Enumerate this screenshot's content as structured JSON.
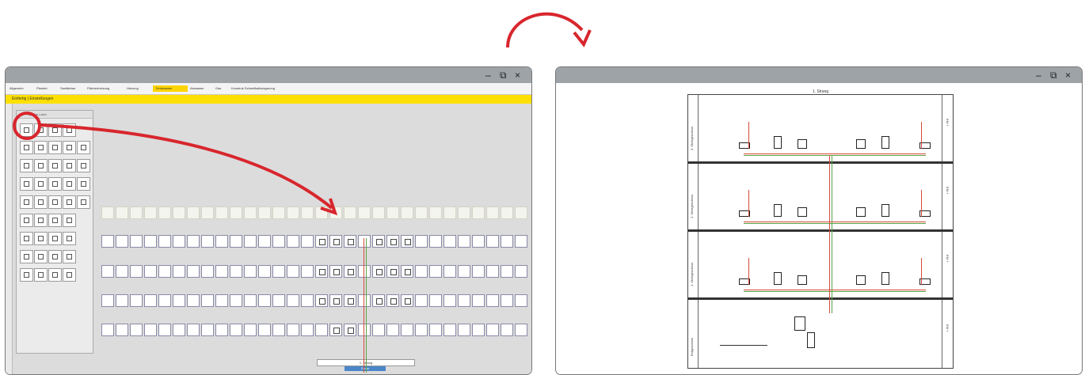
{
  "window_controls": {
    "minimize": "–",
    "maximize": "⧉",
    "close": "×"
  },
  "left_window": {
    "tabs": [
      "Allgemein",
      "Planbet",
      "Sanitärbau",
      "Flächenheizung",
      "Heizung",
      "Trinkwasser",
      "Abwasser",
      "Gas",
      "Konstruk Schnellkalkulagerung"
    ],
    "active_tab_index": 5,
    "breadcrumb": "Einfertig | Einstellungen",
    "palette_header": "System-Ladd",
    "strang_label": "1. Strang",
    "zoom_label": "Zoom"
  },
  "right_window": {
    "drawing_title": "1. Strang",
    "floors": [
      "3. Obergeschoss",
      "2. Obergeschoss",
      "1. Obergeschoss",
      "Erdgeschoss"
    ],
    "floor_codes": [
      "EM +",
      "EM +",
      "EM +",
      "EM +"
    ]
  },
  "colors": {
    "titlebar": "#9ea3a7",
    "highlight": "#ffd400",
    "arrow": "#d8262d",
    "pipe_red": "#d64a3a",
    "pipe_green": "#5aa545"
  },
  "icons": [
    "minimize-icon",
    "maximize-icon",
    "close-icon",
    "curved-arrow-icon",
    "highlight-circle-icon"
  ]
}
